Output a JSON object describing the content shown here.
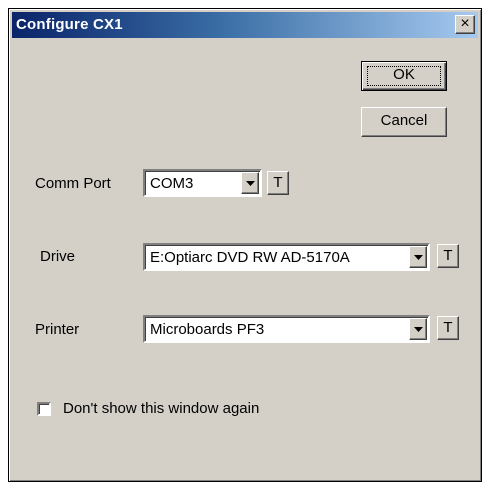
{
  "window": {
    "title": "Configure CX1",
    "close_glyph": "×"
  },
  "buttons": {
    "ok": "OK",
    "cancel": "Cancel"
  },
  "fields": {
    "comm_port": {
      "label": "Comm Port",
      "value": "COM3",
      "test_label": "T"
    },
    "drive": {
      "label": "Drive",
      "value": "E:Optiarc DVD RW AD-5170A",
      "test_label": "T"
    },
    "printer": {
      "label": "Printer",
      "value": "Microboards PF3",
      "test_label": "T"
    }
  },
  "checkbox": {
    "label": "Don't show this window again",
    "checked": false
  },
  "icons": {
    "dropdown": "chevron-down-icon",
    "close": "close-icon"
  }
}
